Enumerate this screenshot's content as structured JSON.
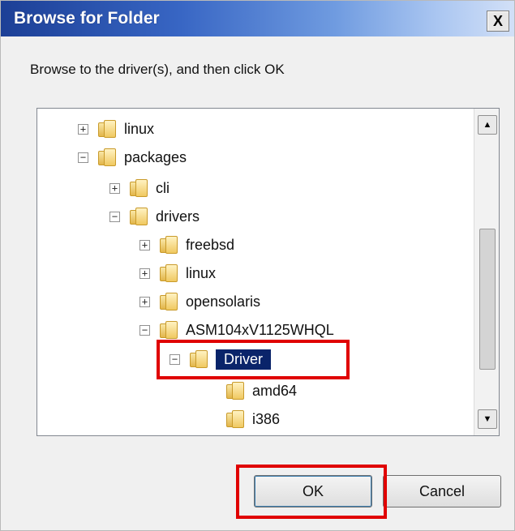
{
  "window": {
    "title": "Browse for Folder",
    "close_glyph": "X"
  },
  "instruction": "Browse to the driver(s), and then click OK",
  "tree": {
    "items": [
      {
        "label": "linux",
        "expander": "+"
      },
      {
        "label": "packages",
        "expander": "−"
      },
      {
        "label": "cli",
        "expander": "+"
      },
      {
        "label": "drivers",
        "expander": "−"
      },
      {
        "label": "freebsd",
        "expander": "+"
      },
      {
        "label": "linux",
        "expander": "+"
      },
      {
        "label": "opensolaris",
        "expander": "+"
      },
      {
        "label": "ASM104xV1125WHQL",
        "expander": "−"
      },
      {
        "label": "Driver",
        "expander": "−",
        "selected": true
      },
      {
        "label": "amd64",
        "expander": ""
      },
      {
        "label": "i386",
        "expander": ""
      }
    ]
  },
  "scrollbar": {
    "up_glyph": "▲",
    "down_glyph": "▼"
  },
  "buttons": {
    "ok": "OK",
    "cancel": "Cancel"
  },
  "highlight_color": "#e00000",
  "selection_color": "#0a246a"
}
